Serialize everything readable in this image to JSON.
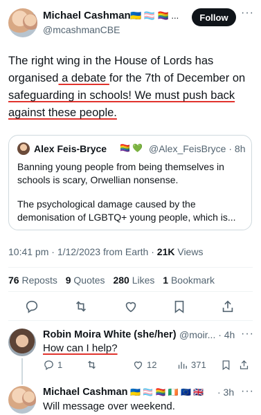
{
  "tweet": {
    "author_name": "Michael Cashman",
    "author_flags": "🇺🇦 🏳️‍⚧️ 🏳️‍🌈 ...",
    "author_handle": "@mcashmanCBE",
    "follow_label": "Follow",
    "more": "···",
    "text_a": "The right wing in the House of Lords has organised",
    "text_b": " a debate ",
    "text_c": "for the 7th of December on ",
    "text_d": "safeguarding in schools! We must push back against these people.",
    "time": "10:41 pm · 1/12/2023 from Earth · ",
    "views_count": "21K",
    "views_label": " Views"
  },
  "quote": {
    "name": "Alex Feis-Bryce",
    "badges": "🏳️‍🌈 💚",
    "handle": "@Alex_FeisBryce · 8h",
    "text1": "Banning young people from being themselves in schools is scary, Orwellian nonsense.",
    "text2": "The psychological damage caused by the demonisation of LGBTQ+ young people, which is..."
  },
  "stats": {
    "reposts_count": "76",
    "reposts_label": "Reposts",
    "quotes_count": "9",
    "quotes_label": "Quotes",
    "likes_count": "280",
    "likes_label": "Likes",
    "bookmarks_count": "1",
    "bookmarks_label": "Bookmark"
  },
  "actions": [
    "reply-icon",
    "repost-icon",
    "like-icon",
    "bookmark-icon",
    "share-icon"
  ],
  "replies": [
    {
      "name": "Robin Moira White (she/her)",
      "handle": "@moir... · 4h",
      "more": "···",
      "text": "How can I help?",
      "reply_count": "1",
      "like_count": "12",
      "views_count": "371"
    },
    {
      "name": "Michael Cashman",
      "flags": "🇺🇦 🏳️‍⚧️ 🏳️‍🌈 🇮🇪 🇪🇺 🇬🇧",
      "time": "· 3h",
      "more": "···",
      "text": "Will message over weekend."
    }
  ],
  "colors": {
    "text": "#0f1419",
    "secondary": "#536471",
    "underline_annotation": "#e0322c",
    "border": "#cfd9de"
  }
}
